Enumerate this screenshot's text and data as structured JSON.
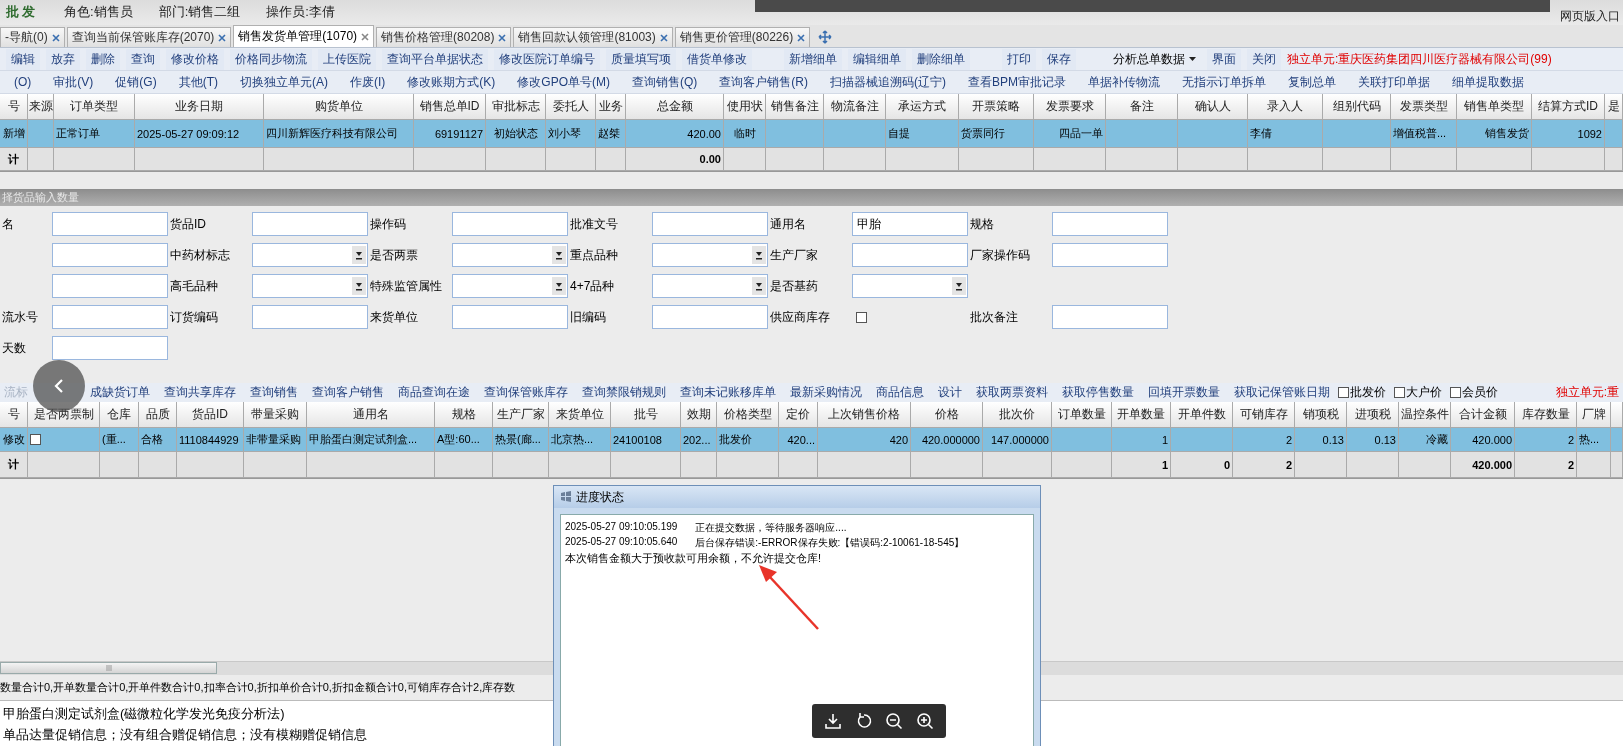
{
  "header": {
    "app": "批发",
    "role": "角色:销售员",
    "dept": "部门:销售二组",
    "operator": "操作员:李倩",
    "web_entry": "网页版入口"
  },
  "tabs": [
    {
      "label": "-导航(0)",
      "selected": false
    },
    {
      "label": "查询当前保管账库存(2070)",
      "selected": false
    },
    {
      "label": "销售发货单管理(1070)",
      "selected": true
    },
    {
      "label": "销售价格管理(80208)",
      "selected": false
    },
    {
      "label": "销售回款认领管理(81003)",
      "selected": false
    },
    {
      "label": "销售更价管理(80226)",
      "selected": false
    }
  ],
  "toolbar1": [
    {
      "kind": "button",
      "label": "编辑"
    },
    {
      "kind": "button",
      "label": "放弃"
    },
    {
      "kind": "button",
      "label": "删除"
    },
    {
      "kind": "button",
      "label": "查询"
    },
    {
      "kind": "button",
      "label": "修改价格"
    },
    {
      "kind": "button",
      "label": "价格同步物流"
    },
    {
      "kind": "button",
      "label": "上传医院"
    },
    {
      "kind": "button",
      "label": "查询平台单据状态"
    },
    {
      "kind": "button",
      "label": "修改医院订单编号"
    },
    {
      "kind": "button",
      "label": "质量填写项"
    },
    {
      "kind": "button",
      "label": "借货单修改"
    },
    {
      "kind": "spacer"
    },
    {
      "kind": "button",
      "label": "新增细单"
    },
    {
      "kind": "button",
      "label": "编辑细单"
    },
    {
      "kind": "button",
      "label": "删除细单"
    },
    {
      "kind": "spacer"
    },
    {
      "kind": "button",
      "label": "打印"
    },
    {
      "kind": "button",
      "label": "保存"
    },
    {
      "kind": "spacer"
    },
    {
      "kind": "dropdown",
      "label": "分析总单数据"
    },
    {
      "kind": "button",
      "label": "界面"
    },
    {
      "kind": "button",
      "label": "关闭"
    },
    {
      "kind": "notice",
      "label": "独立单元:重庆医药集团四川医疗器械有限公司(99)"
    }
  ],
  "toolbar2": [
    "(O)",
    "审批(V)",
    "促销(G)",
    "其他(T)",
    "切换独立单元(A)",
    "作废(I)",
    "修改账期方式(K)",
    "修改GPO单号(M)",
    "查询销售(Q)",
    "查询客户销售(R)",
    "扫描器械追溯码(辽宁)",
    "查看BPM审批记录",
    "单据补传物流",
    "无指示订单拆单",
    "复制总单",
    "关联打印单据",
    "细单提取数据"
  ],
  "order_table": {
    "row_selected": true,
    "columns": [
      {
        "label": "号",
        "row": "新增",
        "total": "计"
      },
      {
        "label": "来源"
      },
      {
        "label": "订单类型",
        "row": "正常订单"
      },
      {
        "label": "业务日期",
        "row": "2025-05-27 09:09:12"
      },
      {
        "label": "购货单位",
        "row": "四川新辉医疗科技有限公司"
      },
      {
        "label": "销售总单ID",
        "row": "69191127"
      },
      {
        "label": "审批标志",
        "row": "初始状态"
      },
      {
        "label": "委托人",
        "row": "刘小琴"
      },
      {
        "label": "业务",
        "row": "赵桀"
      },
      {
        "label": "总金额",
        "row": "420.00",
        "total": "0.00"
      },
      {
        "label": "使用状",
        "row": "临时"
      },
      {
        "label": "销售备注"
      },
      {
        "label": "物流备注"
      },
      {
        "label": "承运方式",
        "row": "自提"
      },
      {
        "label": "开票策略",
        "row": "货票同行"
      },
      {
        "label": "发票要求",
        "row": "四品一单"
      },
      {
        "label": "备注"
      },
      {
        "label": "确认人"
      },
      {
        "label": "录入人",
        "row": "李倩"
      },
      {
        "label": "组别代码"
      },
      {
        "label": "发票类型",
        "row": "增值税普..."
      },
      {
        "label": "销售单类型",
        "row": "销售发货"
      },
      {
        "label": "结算方式ID",
        "row": "1092"
      },
      {
        "label": "是"
      }
    ]
  },
  "form": {
    "title": "择货品输入数量",
    "rows": [
      [
        {
          "kind": "text",
          "label": "名"
        },
        {
          "kind": "text",
          "label": "货品ID"
        },
        {
          "kind": "text",
          "label": "操作码"
        },
        {
          "kind": "text",
          "label": "批准文号"
        },
        {
          "kind": "text",
          "label": "通用名",
          "value": "甲胎"
        },
        {
          "kind": "text",
          "label": "规格"
        }
      ],
      [
        {
          "kind": "text"
        },
        {
          "kind": "select",
          "label": "中药材标志"
        },
        {
          "kind": "select",
          "label": "是否两票"
        },
        {
          "kind": "select",
          "label": "重点品种"
        },
        {
          "kind": "text",
          "label": "生产厂家"
        },
        {
          "kind": "text",
          "label": "厂家操作码"
        }
      ],
      [
        {
          "kind": "text"
        },
        {
          "kind": "select",
          "label": "高毛品种"
        },
        {
          "kind": "select",
          "label": "特殊监管属性"
        },
        {
          "kind": "select",
          "label": "4+7品种"
        },
        {
          "kind": "select",
          "label": "是否基药"
        }
      ],
      [
        {
          "kind": "text",
          "label": "流水号"
        },
        {
          "kind": "text",
          "label": "订货编码"
        },
        {
          "kind": "text",
          "label": "来货单位"
        },
        {
          "kind": "text",
          "label": "旧编码"
        },
        {
          "kind": "checkbox",
          "label": "供应商库存",
          "checked": false
        },
        {
          "kind": "text",
          "label": "批次备注"
        }
      ],
      [
        {
          "kind": "text",
          "label": "天数"
        }
      ]
    ]
  },
  "toolbar3": [
    {
      "kind": "faded",
      "label": "流标"
    },
    {
      "kind": "link",
      "label": "成缺货订单"
    },
    {
      "kind": "link",
      "label": "查询共享库存"
    },
    {
      "kind": "link",
      "label": "查询销售"
    },
    {
      "kind": "link",
      "label": "查询客户销售"
    },
    {
      "kind": "link",
      "label": "商品查询在途"
    },
    {
      "kind": "link",
      "label": "查询保管账库存"
    },
    {
      "kind": "link",
      "label": "查询禁限销规则"
    },
    {
      "kind": "link",
      "label": "查询未记账移库单"
    },
    {
      "kind": "link",
      "label": "最新采购情况"
    },
    {
      "kind": "link",
      "label": "商品信息"
    },
    {
      "kind": "link",
      "label": "设计"
    },
    {
      "kind": "link",
      "label": "获取两票资料"
    },
    {
      "kind": "link",
      "label": "获取停售数量"
    },
    {
      "kind": "link",
      "label": "回填开票数量"
    },
    {
      "kind": "link",
      "label": "获取记保管账日期"
    },
    {
      "kind": "checkbox",
      "label": "批发价",
      "checked": false
    },
    {
      "kind": "checkbox",
      "label": "大户价",
      "checked": false
    },
    {
      "kind": "checkbox",
      "label": "会员价",
      "checked": false
    },
    {
      "kind": "notice",
      "label": "独立单元:重"
    }
  ],
  "detail_table": {
    "row_selected": true,
    "columns": [
      {
        "label": "号",
        "row": "修改",
        "total": "计"
      },
      {
        "label": "是否两票制",
        "checked": false
      },
      {
        "label": "仓库",
        "row": "(重..."
      },
      {
        "label": "品质",
        "row": "合格"
      },
      {
        "label": "货品ID",
        "row": "1110844929"
      },
      {
        "label": "带量采购",
        "row": "非带量采购"
      },
      {
        "label": "通用名",
        "row": "甲胎蛋白测定试剂盒..."
      },
      {
        "label": "规格",
        "row": "A型:60..."
      },
      {
        "label": "生产厂家",
        "row": "热景(廊..."
      },
      {
        "label": "来货单位",
        "row": "北京热..."
      },
      {
        "label": "批号",
        "row": "24100108"
      },
      {
        "label": "效期",
        "row": "202..."
      },
      {
        "label": "价格类型",
        "row": "批发价"
      },
      {
        "label": "定价",
        "row": "420..."
      },
      {
        "label": "上次销售价格",
        "row": "420"
      },
      {
        "label": "价格",
        "row": "420.000000"
      },
      {
        "label": "批次价",
        "row": "147.000000"
      },
      {
        "label": "订单数量"
      },
      {
        "label": "开单数量",
        "row": "1",
        "total": "1"
      },
      {
        "label": "开单件数",
        "total": "0"
      },
      {
        "label": "可销库存",
        "row": "2",
        "total": "2"
      },
      {
        "label": "销项税",
        "row": "0.13"
      },
      {
        "label": "进项税",
        "row": "0.13"
      },
      {
        "label": "温控条件",
        "row": "冷藏"
      },
      {
        "label": "合计金额",
        "row": "420.000",
        "total": "420.000"
      },
      {
        "label": "库存数量",
        "row": "2",
        "total": "2"
      },
      {
        "label": "厂牌",
        "row": "热..."
      }
    ]
  },
  "status_bar": "数量合计0,开单数量合计0,开单件数合计0,扣率合计0,折扣单价合计0,折扣金额合计0,可销库存合计2,库存数",
  "info_panel": [
    "甲胎蛋白测定试剂盒(磁微粒化学发光免疫分析法)",
    "单品达量促销信息；没有组合赠促销信息；没有模糊赠促销信息"
  ],
  "dialog": {
    "title": "进度状态",
    "log": [
      {
        "time": "2025-05-27 09:10:05.199",
        "message": "正在提交数据，等待服务器响应...."
      },
      {
        "time": "2025-05-27 09:10:05.640",
        "message": "后台保存错误:-ERROR保存失败:【错误码:2-10061-18-545】"
      }
    ],
    "note": "本次销售金额大于预收款可用余额，不允许提交仓库!"
  }
}
